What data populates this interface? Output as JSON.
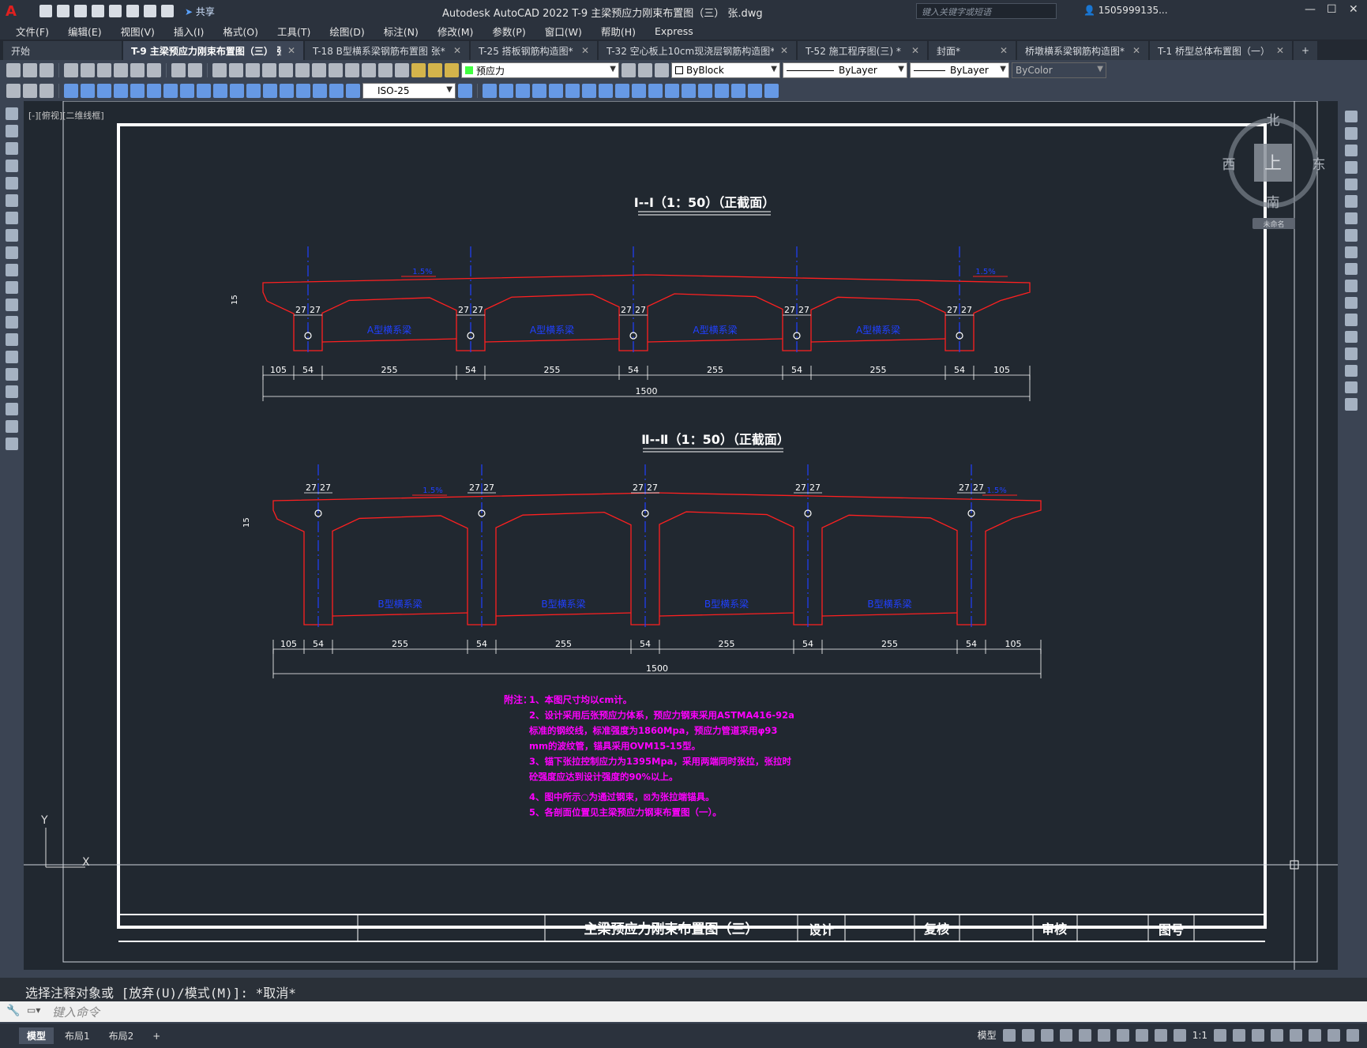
{
  "app": {
    "title": "Autodesk AutoCAD 2022    T-9 主梁预应力刚束布置图（三） 张.dwg",
    "logo": "A",
    "share_label": "共享",
    "search_placeholder": "键入关键字或短语",
    "user": "1505999135...",
    "express": "Express"
  },
  "menu": [
    "文件(F)",
    "编辑(E)",
    "视图(V)",
    "插入(I)",
    "格式(O)",
    "工具(T)",
    "绘图(D)",
    "标注(N)",
    "修改(M)",
    "参数(P)",
    "窗口(W)",
    "帮助(H)",
    "Express"
  ],
  "file_tabs": [
    {
      "label": "开始",
      "active": false
    },
    {
      "label": "T-9 主梁预应力刚束布置图（三） 张*",
      "active": true
    },
    {
      "label": "T-18 B型横系梁钢筋布置图  张*",
      "active": false
    },
    {
      "label": "T-25 搭板钢筋构造图*",
      "active": false
    },
    {
      "label": "T-32 空心板上10cm现浇层钢筋构造图*",
      "active": false
    },
    {
      "label": "T-52 施工程序图(三) *",
      "active": false
    },
    {
      "label": "封面*",
      "active": false
    },
    {
      "label": "桥墩横系梁钢筋构造图*",
      "active": false
    },
    {
      "label": "T-1 桥型总体布置图（一） *",
      "active": false
    }
  ],
  "toolbar": {
    "layer": "预应力",
    "color": "ByBlock",
    "linetype": "ByLayer",
    "lineweight": "ByLayer",
    "plotstyle": "ByColor",
    "dimstyle": "ISO-25"
  },
  "viewport_label": "[-][俯视][二维线框]",
  "viewcube": {
    "n": "北",
    "s": "南",
    "e": "东",
    "w": "西",
    "top": "上",
    "ucs": "未命名"
  },
  "drawing": {
    "section1": {
      "title": "Ⅰ--Ⅰ（1：50）（正截面）",
      "slope_left": "1.5%",
      "slope_right": "1.5%",
      "web_label": "A型横系梁"
    },
    "section2": {
      "title": "Ⅱ--Ⅱ（1：50）（正截面）",
      "slope_left": "1.5%",
      "slope_right": "1.5%",
      "web_label": "B型横系梁"
    },
    "dims": {
      "side": "105",
      "web": "54",
      "bay": "255",
      "half": "27",
      "total": "1500",
      "flange": "15"
    },
    "notes": {
      "head": "附注：",
      "lines": [
        "1、本图尺寸均以cm计。",
        "2、设计采用后张预应力体系，预应力钢束采用ASTMA416-92a",
        "   标准的钢绞线，标准强度为1860Mpa，预应力管道采用φ93",
        "   mm的波纹管，锚具采用OVM15-15型。",
        "3、锚下张拉控制应力为1395Mpa，采用两端同时张拉，张拉时",
        "   砼强度应达到设计强度的90%以上。",
        "4、图中所示○为通过钢束，⊠为张拉端锚具。",
        "5、各剖面位置见主梁预应力钢束布置图（一）。"
      ]
    },
    "titleblock": {
      "title": "主梁预应力刚束布置图（三）",
      "design": "设计",
      "check": "复核",
      "review": "审核",
      "number": "图号"
    }
  },
  "command": {
    "history": "选择注释对象或 [放弃(U)/模式(M)]: *取消*",
    "placeholder": "键入命令"
  },
  "layout_tabs": [
    "模型",
    "布局1",
    "布局2"
  ],
  "status": {
    "model": "模型",
    "scale": "1:1"
  },
  "colors": {
    "red": "#ff2020",
    "blue": "#2040ff",
    "magenta": "#ff00ff",
    "white": "#ffffff",
    "bg": "#212830"
  }
}
